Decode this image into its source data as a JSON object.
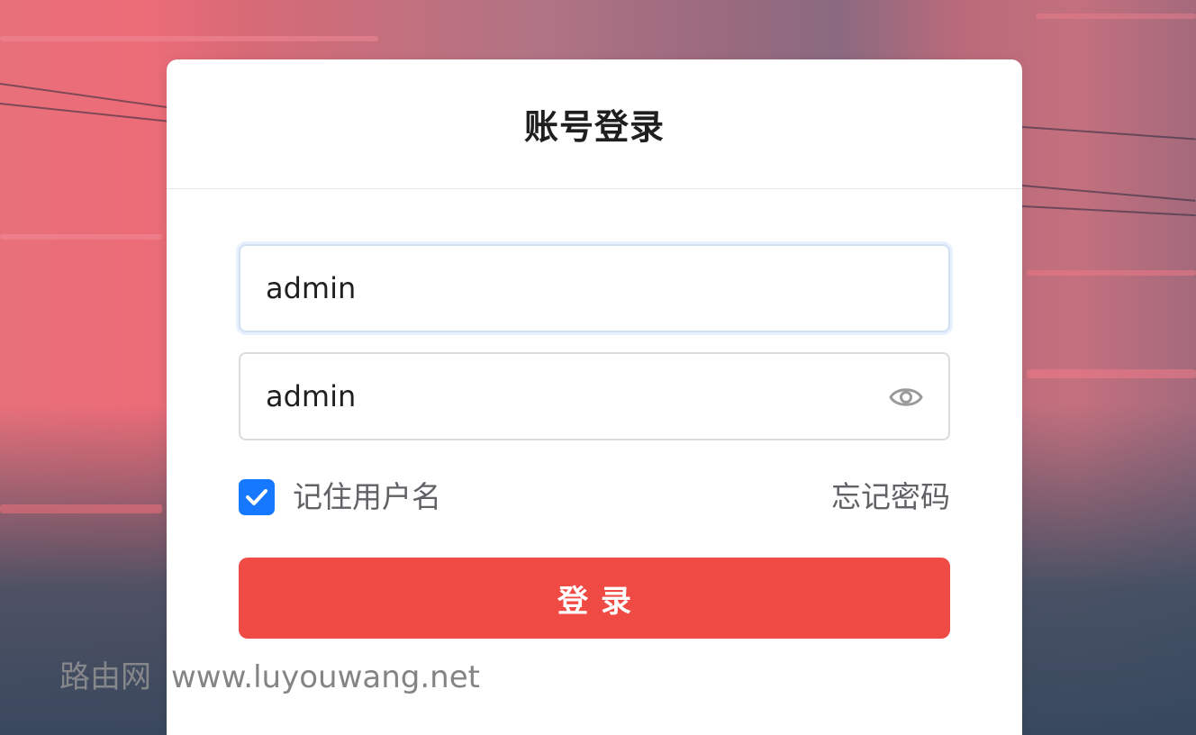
{
  "login": {
    "title": "账号登录",
    "username": {
      "value": "admin"
    },
    "password": {
      "value": "admin",
      "toggle_icon": "eye-icon"
    },
    "remember": {
      "label": "记住用户名",
      "checked": true,
      "check_icon": "checkmark-icon"
    },
    "forgot_label": "忘记密码",
    "submit_label": "登录"
  },
  "watermark": {
    "site_name": "路由网",
    "url": "www.luyouwang.net"
  },
  "colors": {
    "primary_button": "#ef4a43",
    "checkbox": "#1677ff",
    "focus_border": "#cfe0f5"
  }
}
